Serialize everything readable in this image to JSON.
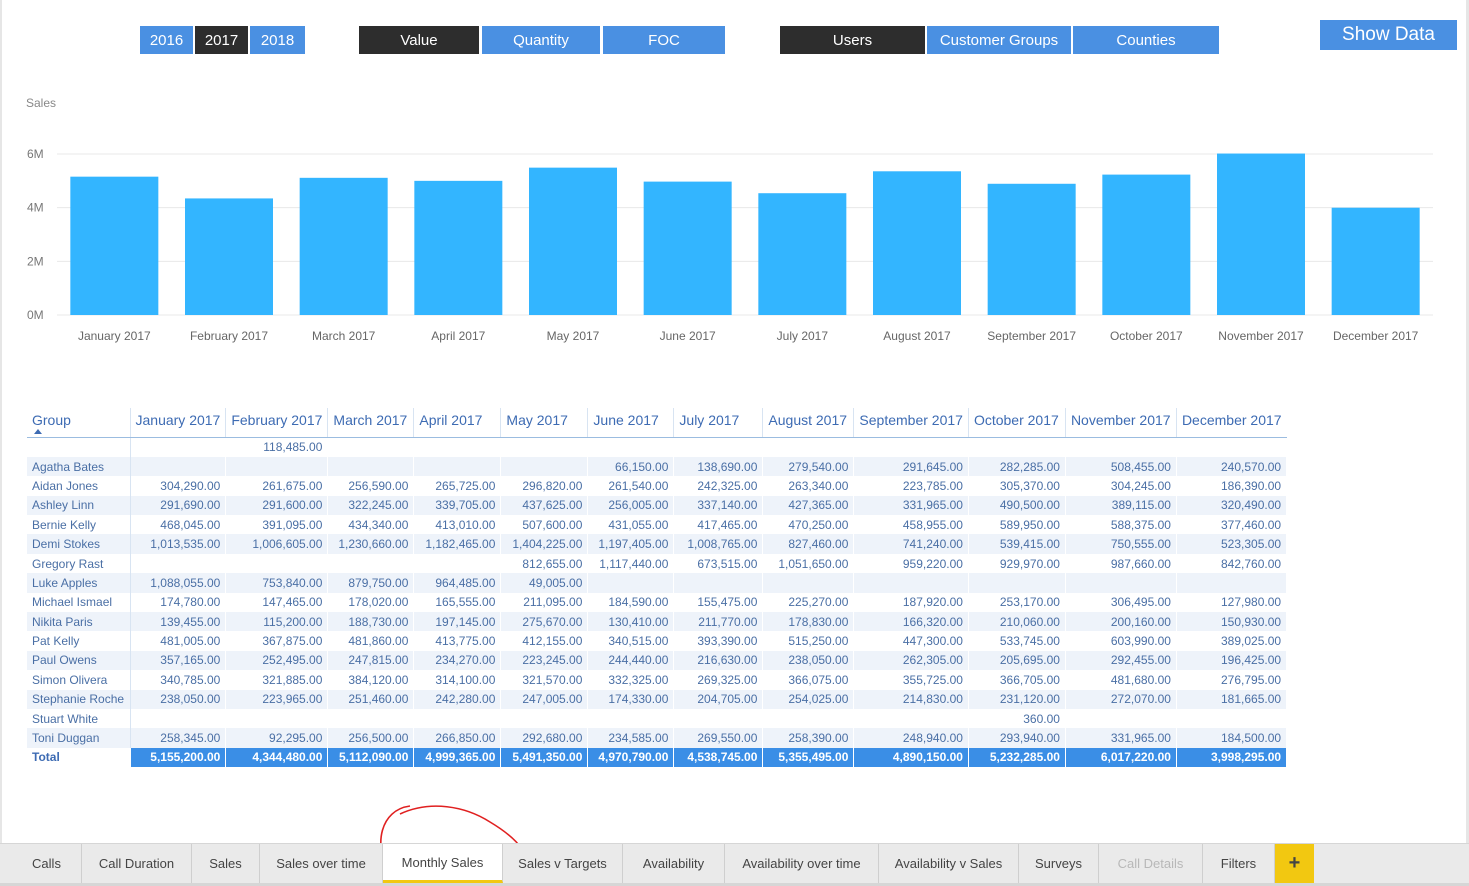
{
  "years": [
    "2016",
    "2017",
    "2018"
  ],
  "selected_year": "2017",
  "measures": [
    "Value",
    "Quantity",
    "FOC"
  ],
  "selected_measure": "Value",
  "groupings": [
    "Users",
    "Customer Groups",
    "Counties"
  ],
  "selected_grouping": "Users",
  "show_data_label": "Show Data",
  "chart_data": {
    "type": "bar",
    "ylabel": "Sales",
    "categories": [
      "January 2017",
      "February 2017",
      "March 2017",
      "April 2017",
      "May 2017",
      "June 2017",
      "July 2017",
      "August 2017",
      "September 2017",
      "October 2017",
      "November 2017",
      "December 2017"
    ],
    "values": [
      5155200,
      4344480,
      5112090,
      4999365,
      5491350,
      4970790,
      4538745,
      5355495,
      4890150,
      5232285,
      6017220,
      3998295
    ],
    "yticks": [
      "0M",
      "2M",
      "4M",
      "6M"
    ],
    "ylim": [
      0,
      6000000
    ],
    "grid": true,
    "color": "#33b5ff"
  },
  "table": {
    "group_header": "Group",
    "columns": [
      "January 2017",
      "February 2017",
      "March 2017",
      "April 2017",
      "May 2017",
      "June 2017",
      "July 2017",
      "August 2017",
      "September 2017",
      "October 2017",
      "November 2017",
      "December 2017"
    ],
    "rows": [
      {
        "group": "",
        "values": [
          "",
          "118,485.00",
          "",
          "",
          "",
          "",
          "",
          "",
          "",
          "",
          "",
          ""
        ]
      },
      {
        "group": "Agatha Bates",
        "values": [
          "",
          "",
          "",
          "",
          "",
          "66,150.00",
          "138,690.00",
          "279,540.00",
          "291,645.00",
          "282,285.00",
          "508,455.00",
          "240,570.00"
        ]
      },
      {
        "group": "Aidan Jones",
        "values": [
          "304,290.00",
          "261,675.00",
          "256,590.00",
          "265,725.00",
          "296,820.00",
          "261,540.00",
          "242,325.00",
          "263,340.00",
          "223,785.00",
          "305,370.00",
          "304,245.00",
          "186,390.00"
        ]
      },
      {
        "group": "Ashley Linn",
        "values": [
          "291,690.00",
          "291,600.00",
          "322,245.00",
          "339,705.00",
          "437,625.00",
          "256,005.00",
          "337,140.00",
          "427,365.00",
          "331,965.00",
          "490,500.00",
          "389,115.00",
          "320,490.00"
        ]
      },
      {
        "group": "Bernie Kelly",
        "values": [
          "468,045.00",
          "391,095.00",
          "434,340.00",
          "413,010.00",
          "507,600.00",
          "431,055.00",
          "417,465.00",
          "470,250.00",
          "458,955.00",
          "589,950.00",
          "588,375.00",
          "377,460.00"
        ]
      },
      {
        "group": "Demi Stokes",
        "values": [
          "1,013,535.00",
          "1,006,605.00",
          "1,230,660.00",
          "1,182,465.00",
          "1,404,225.00",
          "1,197,405.00",
          "1,008,765.00",
          "827,460.00",
          "741,240.00",
          "539,415.00",
          "750,555.00",
          "523,305.00"
        ]
      },
      {
        "group": "Gregory Rast",
        "values": [
          "",
          "",
          "",
          "",
          "812,655.00",
          "1,117,440.00",
          "673,515.00",
          "1,051,650.00",
          "959,220.00",
          "929,970.00",
          "987,660.00",
          "842,760.00"
        ]
      },
      {
        "group": "Luke Apples",
        "values": [
          "1,088,055.00",
          "753,840.00",
          "879,750.00",
          "964,485.00",
          "49,005.00",
          "",
          "",
          "",
          "",
          "",
          "",
          ""
        ]
      },
      {
        "group": "Michael Ismael",
        "values": [
          "174,780.00",
          "147,465.00",
          "178,020.00",
          "165,555.00",
          "211,095.00",
          "184,590.00",
          "155,475.00",
          "225,270.00",
          "187,920.00",
          "253,170.00",
          "306,495.00",
          "127,980.00"
        ]
      },
      {
        "group": "Nikita Paris",
        "values": [
          "139,455.00",
          "115,200.00",
          "188,730.00",
          "197,145.00",
          "275,670.00",
          "130,410.00",
          "211,770.00",
          "178,830.00",
          "166,320.00",
          "210,060.00",
          "200,160.00",
          "150,930.00"
        ]
      },
      {
        "group": "Pat Kelly",
        "values": [
          "481,005.00",
          "367,875.00",
          "481,860.00",
          "413,775.00",
          "412,155.00",
          "340,515.00",
          "393,390.00",
          "515,250.00",
          "447,300.00",
          "533,745.00",
          "603,990.00",
          "389,025.00"
        ]
      },
      {
        "group": "Paul Owens",
        "values": [
          "357,165.00",
          "252,495.00",
          "247,815.00",
          "234,270.00",
          "223,245.00",
          "244,440.00",
          "216,630.00",
          "238,050.00",
          "262,305.00",
          "205,695.00",
          "292,455.00",
          "196,425.00"
        ]
      },
      {
        "group": "Simon Olivera",
        "values": [
          "340,785.00",
          "321,885.00",
          "384,120.00",
          "314,100.00",
          "321,570.00",
          "332,325.00",
          "269,325.00",
          "366,075.00",
          "355,725.00",
          "366,705.00",
          "481,680.00",
          "276,795.00"
        ]
      },
      {
        "group": "Stephanie Roche",
        "values": [
          "238,050.00",
          "223,965.00",
          "251,460.00",
          "242,280.00",
          "247,005.00",
          "174,330.00",
          "204,705.00",
          "254,025.00",
          "214,830.00",
          "231,120.00",
          "272,070.00",
          "181,665.00"
        ]
      },
      {
        "group": "Stuart White",
        "values": [
          "",
          "",
          "",
          "",
          "",
          "",
          "",
          "",
          "",
          "360.00",
          "",
          ""
        ]
      },
      {
        "group": "Toni Duggan",
        "values": [
          "258,345.00",
          "92,295.00",
          "256,500.00",
          "266,850.00",
          "292,680.00",
          "234,585.00",
          "269,550.00",
          "258,390.00",
          "248,940.00",
          "293,940.00",
          "331,965.00",
          "184,500.00"
        ]
      }
    ],
    "total": {
      "group": "Total",
      "values": [
        "5,155,200.00",
        "4,344,480.00",
        "5,112,090.00",
        "4,999,365.00",
        "5,491,350.00",
        "4,970,790.00",
        "4,538,745.00",
        "5,355,495.00",
        "4,890,150.00",
        "5,232,285.00",
        "6,017,220.00",
        "3,998,295.00"
      ]
    }
  },
  "tabs": [
    {
      "label": "Calls",
      "state": "normal"
    },
    {
      "label": "Call Duration",
      "state": "normal"
    },
    {
      "label": "Sales",
      "state": "normal"
    },
    {
      "label": "Sales over time",
      "state": "normal"
    },
    {
      "label": "Monthly Sales",
      "state": "active"
    },
    {
      "label": "Sales v Targets",
      "state": "normal"
    },
    {
      "label": "Availability",
      "state": "normal"
    },
    {
      "label": "Availability over time",
      "state": "normal"
    },
    {
      "label": "Availability v Sales",
      "state": "normal"
    },
    {
      "label": "Surveys",
      "state": "normal"
    },
    {
      "label": "Call Details",
      "state": "disabled"
    },
    {
      "label": "Filters",
      "state": "normal"
    }
  ],
  "add_tab_label": "+",
  "colors": {
    "button": "#4a90e2",
    "button_selected": "#2d2d2d",
    "bar": "#33b5ff",
    "total_row": "#3a8ee6",
    "tab_accent": "#f2c811",
    "annotation": "#e02020"
  }
}
